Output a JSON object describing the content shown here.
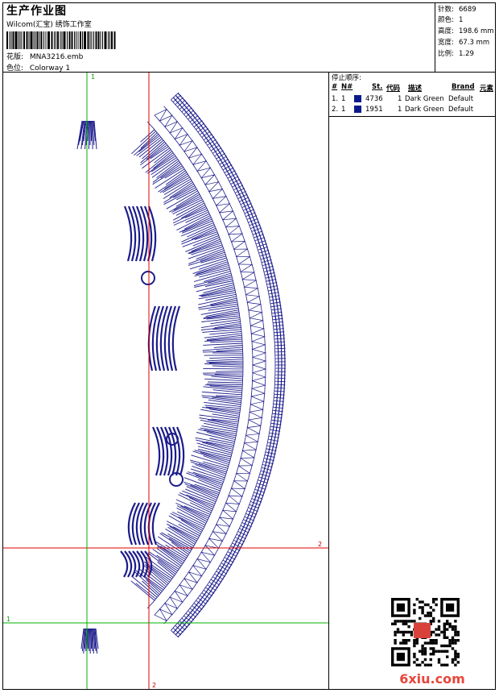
{
  "header": {
    "title": "生产作业图",
    "subtitle": "Wilcom(汇宝) 绣饰工作室",
    "design_label": "花版:",
    "design_value": "MNA3216.emb",
    "colorway_label": "色位:",
    "colorway_value": "Colorway 1"
  },
  "stats": [
    {
      "label": "针数:",
      "value": "6689"
    },
    {
      "label": "颜色:",
      "value": "1"
    },
    {
      "label": "高度:",
      "value": "198.6 mm"
    },
    {
      "label": "宽度:",
      "value": "67.3 mm"
    },
    {
      "label": "比例:",
      "value": "1.29"
    }
  ],
  "stop_sequence": {
    "title": "停止顺序:",
    "headers": {
      "num": "#",
      "n": "N#",
      "st": "St.",
      "code": "代码",
      "desc": "描述",
      "brand": "Brand",
      "elem": "元素"
    },
    "rows": [
      {
        "num": "1.",
        "n": "1",
        "st": "4736",
        "code": "1",
        "desc": "Dark Green",
        "brand": "Default",
        "color": "#0a1a8a"
      },
      {
        "num": "2.",
        "n": "1",
        "st": "1951",
        "code": "1",
        "desc": "Dark Green",
        "brand": "Default",
        "color": "#0a1a8a"
      }
    ]
  },
  "markers": {
    "start_1": "1",
    "start_2": "2",
    "end_1": "1",
    "end_2": "2"
  },
  "watermark": {
    "text": "6xiu.com"
  },
  "colors": {
    "thread": "#1c1c8c",
    "guide_red": "#e00000",
    "guide_green": "#00b000",
    "watermark": "#e8463a"
  }
}
